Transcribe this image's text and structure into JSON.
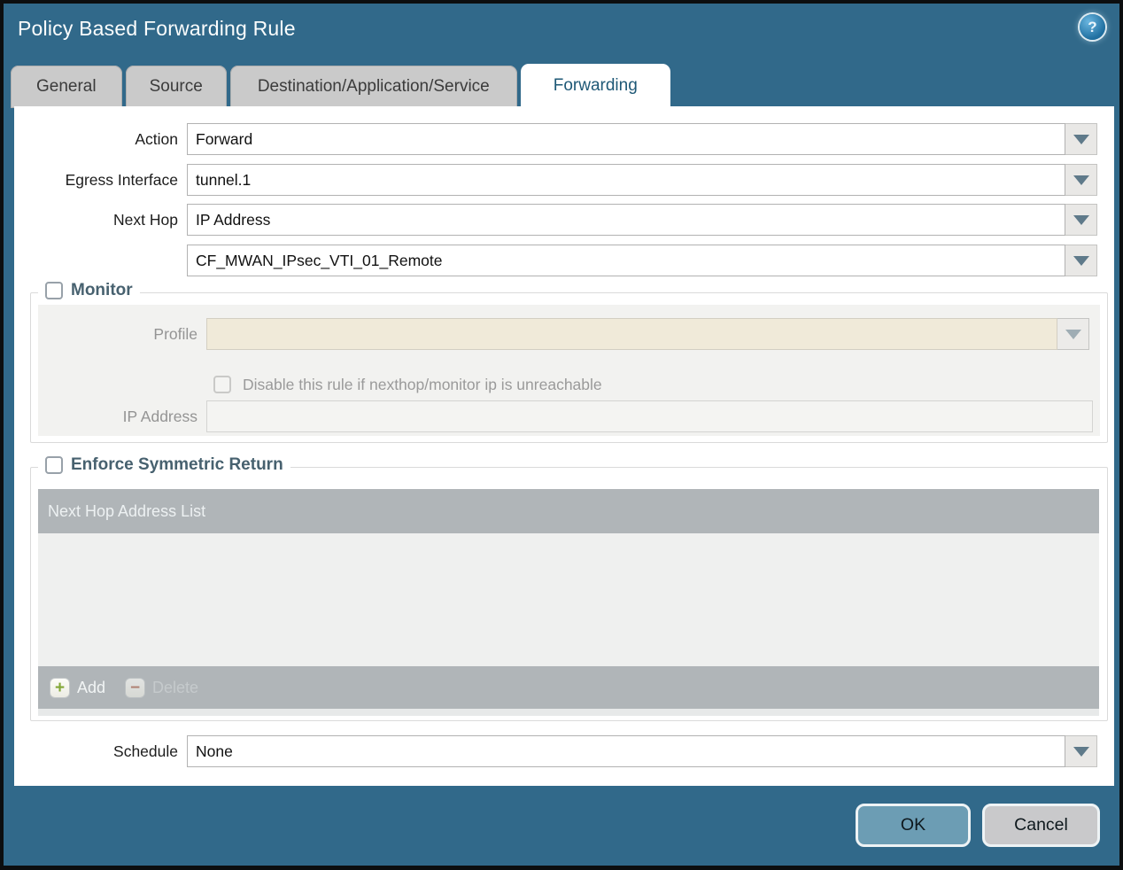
{
  "dialog": {
    "title": "Policy Based Forwarding Rule",
    "help_glyph": "?"
  },
  "tabs": [
    {
      "label": "General",
      "active": false
    },
    {
      "label": "Source",
      "active": false
    },
    {
      "label": "Destination/Application/Service",
      "active": false
    },
    {
      "label": "Forwarding",
      "active": true
    }
  ],
  "form": {
    "action": {
      "label": "Action",
      "value": "Forward"
    },
    "egress_interface": {
      "label": "Egress Interface",
      "value": "tunnel.1"
    },
    "next_hop": {
      "label": "Next Hop",
      "value": "IP Address"
    },
    "next_hop_address": {
      "value": "CF_MWAN_IPsec_VTI_01_Remote"
    },
    "schedule": {
      "label": "Schedule",
      "value": "None"
    }
  },
  "monitor": {
    "title": "Monitor",
    "checked": false,
    "profile": {
      "label": "Profile",
      "value": ""
    },
    "disable_rule": {
      "label": "Disable this rule if nexthop/monitor ip is unreachable",
      "checked": false
    },
    "ip_address": {
      "label": "IP Address",
      "value": ""
    }
  },
  "enforce_symmetric_return": {
    "title": "Enforce Symmetric Return",
    "checked": false,
    "table": {
      "header": "Next Hop Address List",
      "rows": []
    },
    "add_label": "Add",
    "delete_label": "Delete",
    "delete_enabled": false
  },
  "footer": {
    "ok_label": "OK",
    "cancel_label": "Cancel"
  },
  "colors": {
    "dialog_teal": "#31698a",
    "active_tab_text": "#1e5876",
    "section_title": "#47616f",
    "table_gray": "#b0b5b8",
    "disabled_beige": "#f0ead9",
    "ok_button": "#6c9db4",
    "cancel_button": "#c9c9cb",
    "add_plus_green": "#82a736",
    "delete_minus_red": "#b06a52"
  }
}
